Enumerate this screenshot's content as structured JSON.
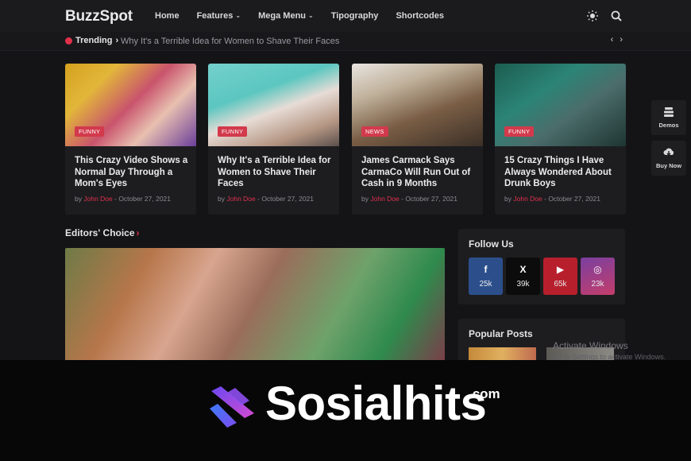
{
  "header": {
    "logo": "BuzzSpot",
    "nav": [
      {
        "label": "Home",
        "dropdown": false
      },
      {
        "label": "Features",
        "dropdown": true
      },
      {
        "label": "Mega Menu",
        "dropdown": true
      },
      {
        "label": "Tipography",
        "dropdown": false
      },
      {
        "label": "Shortcodes",
        "dropdown": false
      }
    ],
    "icons": [
      "sun-icon",
      "search-icon"
    ]
  },
  "trending": {
    "label": "Trending",
    "arrow": "›",
    "headline": "Why It's a Terrible Idea for Women to Shave Their Faces",
    "prev": "‹",
    "next": "›"
  },
  "cards": [
    {
      "badge": "FUNNY",
      "title": "This Crazy Video Shows a Normal Day Through a Mom's Eyes",
      "by": "by",
      "author": "John Doe",
      "date": "- October 27, 2021"
    },
    {
      "badge": "FUNNY",
      "title": "Why It's a Terrible Idea for Women to Shave Their Faces",
      "by": "by",
      "author": "John Doe",
      "date": "- October 27, 2021"
    },
    {
      "badge": "NEWS",
      "title": "James Carmack Says CarmaCo Will Run Out of Cash in 9 Months",
      "by": "by",
      "author": "John Doe",
      "date": "- October 27, 2021"
    },
    {
      "badge": "FUNNY",
      "title": "15 Crazy Things I Have Always Wondered About Drunk Boys",
      "by": "by",
      "author": "John Doe",
      "date": "- October 27, 2021"
    }
  ],
  "editors_choice": {
    "title": "Editors' Choice",
    "chevron": "›"
  },
  "follow_us": {
    "title": "Follow Us",
    "networks": [
      {
        "icon": "facebook-icon",
        "glyph": "f",
        "count": "25k",
        "color": "#2c4f8c"
      },
      {
        "icon": "x-icon",
        "glyph": "X",
        "count": "39k",
        "color": "#0c0c0d"
      },
      {
        "icon": "youtube-icon",
        "glyph": "▶",
        "count": "65k",
        "color": "#b81f2c"
      },
      {
        "icon": "instagram-icon",
        "glyph": "◎",
        "count": "23k",
        "color": "#c43e6b"
      }
    ]
  },
  "popular_posts": {
    "title": "Popular Posts"
  },
  "watermark": {
    "title": "Activate Windows",
    "subtitle": "Go to Settings to activate Windows."
  },
  "floating": [
    {
      "label": "Demos",
      "icon": "stack-icon"
    },
    {
      "label": "Buy Now",
      "icon": "cloud-download-icon"
    }
  ],
  "banner": {
    "brand": "Sosialhits",
    "tld": ".com",
    "accent_colors": [
      "#8a3cf0",
      "#4a7ef5",
      "#e03f8a"
    ]
  }
}
